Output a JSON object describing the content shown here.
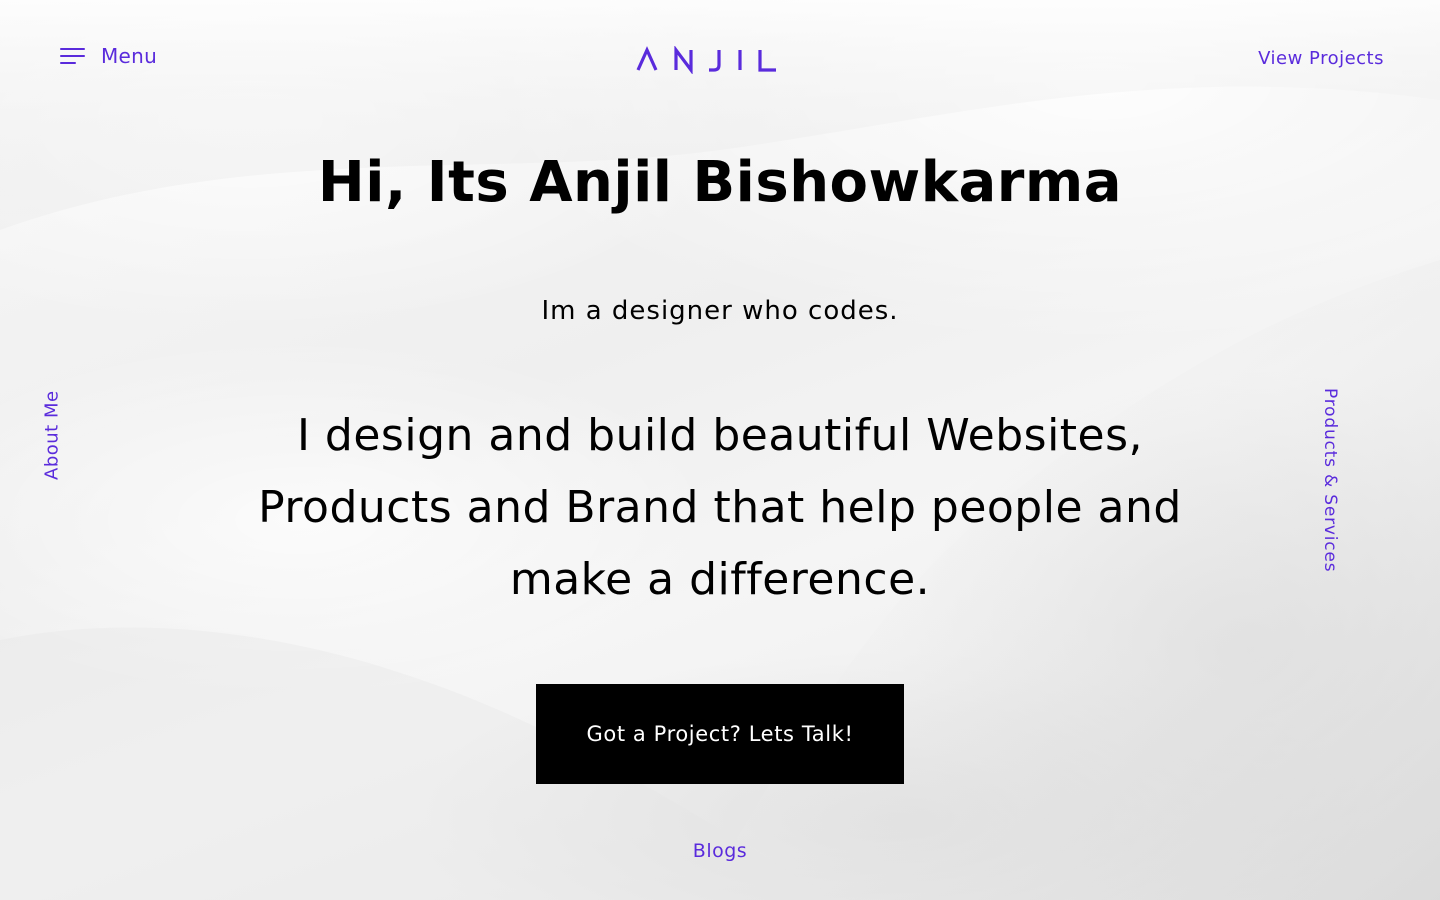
{
  "header": {
    "menu_label": "Menu",
    "logo_text": "ANJIL",
    "view_projects": "View Projects"
  },
  "side": {
    "about_me": "About Me",
    "products_services": "Products & Services"
  },
  "hero": {
    "title": "Hi, Its Anjil Bishowkarma",
    "tagline": "Im a designer who codes.",
    "statement": "I design and build beautiful Websites, Products and Brand that help people and make a difference.",
    "cta_label": "Got a Project? Lets Talk!"
  },
  "footer": {
    "blogs": "Blogs"
  },
  "colors": {
    "accent": "#5a2bdc",
    "text": "#000000",
    "cta_bg": "#000000",
    "cta_text": "#ffffff"
  },
  "icons": {
    "menu": "hamburger-icon"
  }
}
